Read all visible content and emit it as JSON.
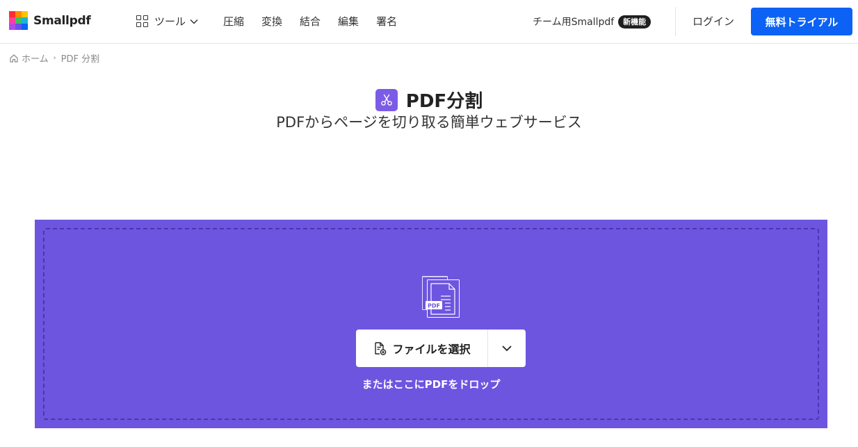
{
  "brand": {
    "name": "Smallpdf"
  },
  "header": {
    "tools_label": "ツール",
    "nav": [
      "圧縮",
      "変換",
      "結合",
      "編集",
      "署名"
    ],
    "team_label": "チーム用Smallpdf",
    "team_badge": "新機能",
    "login_label": "ログイン",
    "trial_label": "無料トライアル"
  },
  "breadcrumb": {
    "home": "ホーム",
    "current": "PDF 分割"
  },
  "main": {
    "title": "PDF分割",
    "subtitle": "PDFからページを切り取る簡単ウェブサービス",
    "select_label": "ファイルを選択",
    "drop_text": "またはここにPDFをドロップ",
    "illustration_label": "PDF"
  },
  "colors": {
    "accent": "#0b62f5",
    "dropzone": "#6e55e0",
    "tool_icon": "#7c5ce6"
  }
}
